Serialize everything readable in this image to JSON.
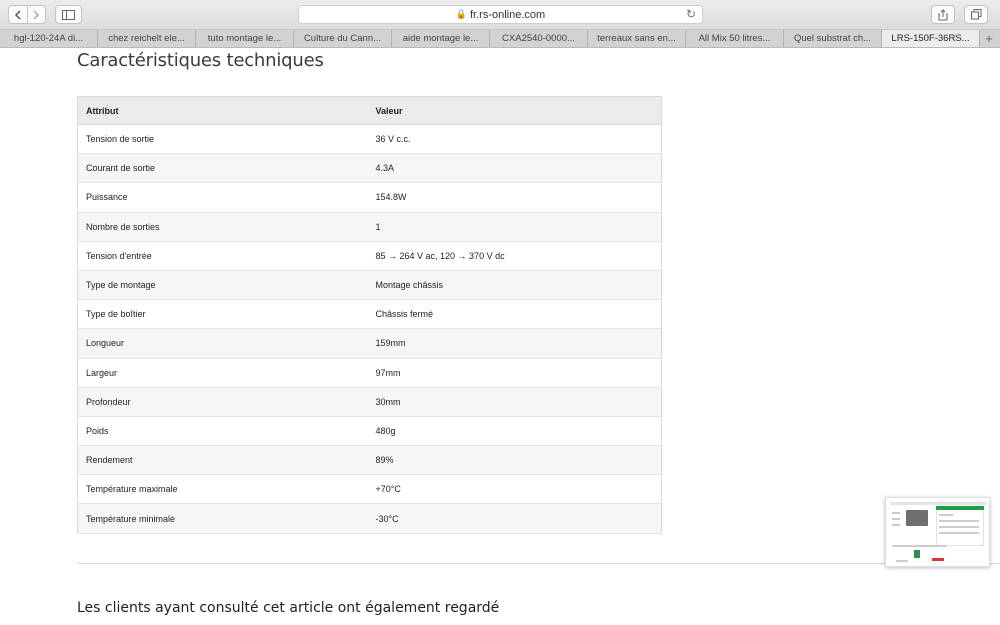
{
  "browser": {
    "url": "fr.rs-online.com",
    "tabs": [
      "hgl-120-24A di...",
      "chez reichelt ele...",
      "tuto montage le...",
      "Culture du Cann...",
      "aide montage le...",
      "CXA2540-0000...",
      "terreaux sans en...",
      "All Mix 50 litres...",
      "Quel substrat ch...",
      "LRS-150F-36RS..."
    ],
    "active_tab_index": 9
  },
  "page": {
    "heading": "Caractéristiques techniques",
    "table": {
      "headers": [
        "Attribut",
        "Valeur"
      ],
      "rows": [
        [
          "Tension de sortie",
          "36 V c.c."
        ],
        [
          "Courant de sortie",
          "4.3A"
        ],
        [
          "Puissance",
          "154.8W"
        ],
        [
          "Nombre de sorties",
          "1"
        ],
        [
          "Tension d'entrée",
          "85 → 264 V ac, 120 → 370 V dc"
        ],
        [
          "Type de montage",
          "Montage châssis"
        ],
        [
          "Type de boîtier",
          "Châssis fermé"
        ],
        [
          "Longueur",
          "159mm"
        ],
        [
          "Largeur",
          "97mm"
        ],
        [
          "Profondeur",
          "30mm"
        ],
        [
          "Poids",
          "480g"
        ],
        [
          "Rendement",
          "89%"
        ],
        [
          "Température maximale",
          "+70°C"
        ],
        [
          "Température minimale",
          "-30°C"
        ]
      ]
    },
    "related_heading": "Les clients ayant consulté cet article ont également regardé"
  },
  "icons": {
    "back": "chevron-left-icon",
    "forward": "chevron-right-icon",
    "sidebar": "sidebar-icon",
    "lock": "lock-icon",
    "reload": "reload-icon",
    "share": "share-icon",
    "tabs": "tabs-overview-icon",
    "new_tab": "plus-icon"
  }
}
